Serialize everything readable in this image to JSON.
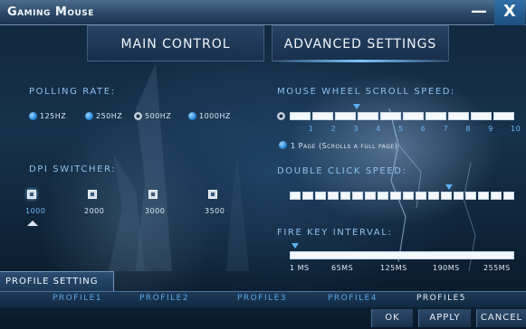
{
  "window": {
    "title": "Gaming Mouse",
    "minimize_glyph": "—",
    "close_glyph": "X"
  },
  "tabs": [
    {
      "label": "MAIN CONTROL"
    },
    {
      "label": "ADVANCED SETTINGS"
    }
  ],
  "polling": {
    "label": "POLLING RATE:",
    "options": [
      {
        "label": "125HZ",
        "selected": false
      },
      {
        "label": "250HZ",
        "selected": false
      },
      {
        "label": "500HZ",
        "selected": true
      },
      {
        "label": "1000HZ",
        "selected": false
      }
    ]
  },
  "dpi": {
    "label": "DPI SWITCHER:",
    "levels": [
      {
        "label": "1000",
        "active": true
      },
      {
        "label": "2000",
        "active": false
      },
      {
        "label": "3000",
        "active": false
      },
      {
        "label": "3500",
        "active": false
      }
    ]
  },
  "scroll": {
    "label": "MOUSE WHEEL SCROLL SPEED:",
    "ticks": [
      "1",
      "2",
      "3",
      "4",
      "5",
      "6",
      "7",
      "8",
      "9",
      "10"
    ],
    "value": 3,
    "page_option": "1 Page (Scrolls a full page)"
  },
  "double_click": {
    "label": "DOUBLE CLICK SPEED:",
    "segments": 18,
    "value_fraction": 0.71
  },
  "fire_key": {
    "label": "FIRE KEY INTERVAL:",
    "ticks": [
      "1 MS",
      "65MS",
      "125MS",
      "190MS",
      "255MS"
    ],
    "value_fraction": 0.0
  },
  "profile_setting": "PROFILE SETTING",
  "profiles": [
    "PROFILE1",
    "PROFILE2",
    "PROFILE3",
    "PROFILE4",
    "PROFILE5"
  ],
  "active_profile": 5,
  "buttons": {
    "ok": "OK",
    "apply": "APPLY",
    "cancel": "CANCEL"
  },
  "colors": {
    "accent": "#5bb0f0",
    "label": "#8ec0ec",
    "title_bar": "#2b4866"
  }
}
